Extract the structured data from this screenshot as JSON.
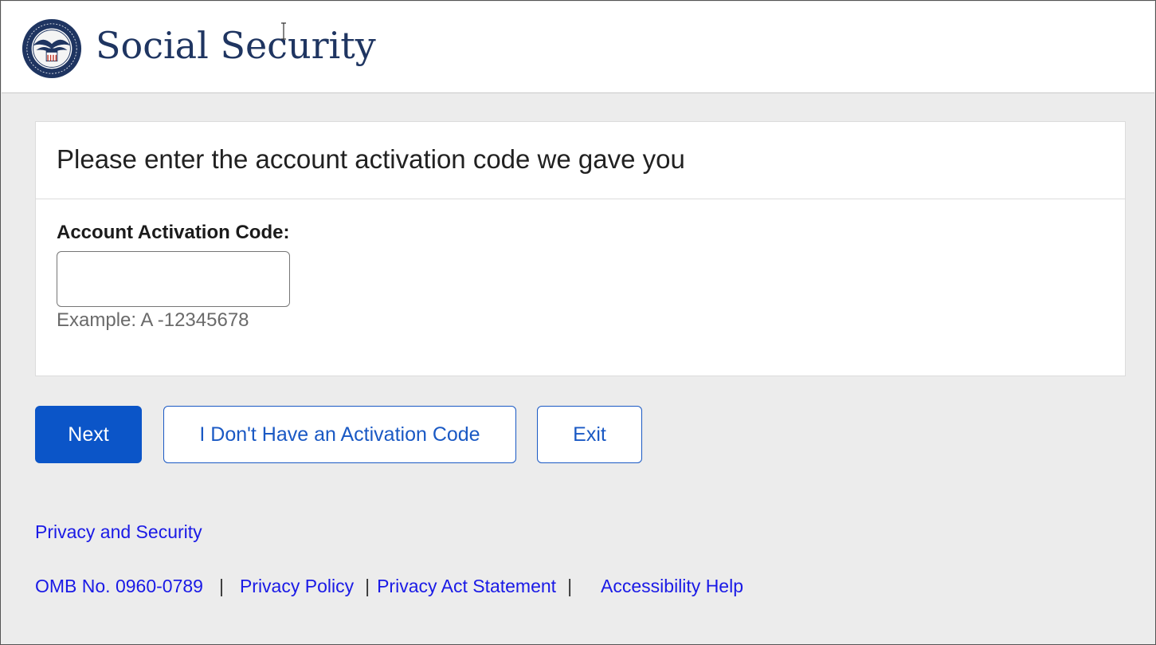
{
  "header": {
    "brand": "Social Security",
    "logo_icon": "ssa-seal-icon"
  },
  "card": {
    "title": "Please enter the account activation code we gave you",
    "field_label": "Account Activation Code:",
    "input_value": "",
    "input_placeholder": "",
    "hint": "Example: A -12345678"
  },
  "buttons": {
    "next": "Next",
    "no_code": "I Don't Have an Activation Code",
    "exit": "Exit"
  },
  "links": {
    "privacy_security": "Privacy and Security"
  },
  "footer": {
    "omb": "OMB No. 0960-0789",
    "sep1": "|",
    "privacy_policy": "Privacy Policy",
    "sep2": "|",
    "privacy_act": "Privacy Act Statement",
    "sep3": "|",
    "accessibility": "Accessibility Help"
  },
  "colors": {
    "brand_navy": "#1f3561",
    "primary_button": "#0b55c8",
    "link": "#1a1ae6",
    "page_background": "#ececec"
  }
}
